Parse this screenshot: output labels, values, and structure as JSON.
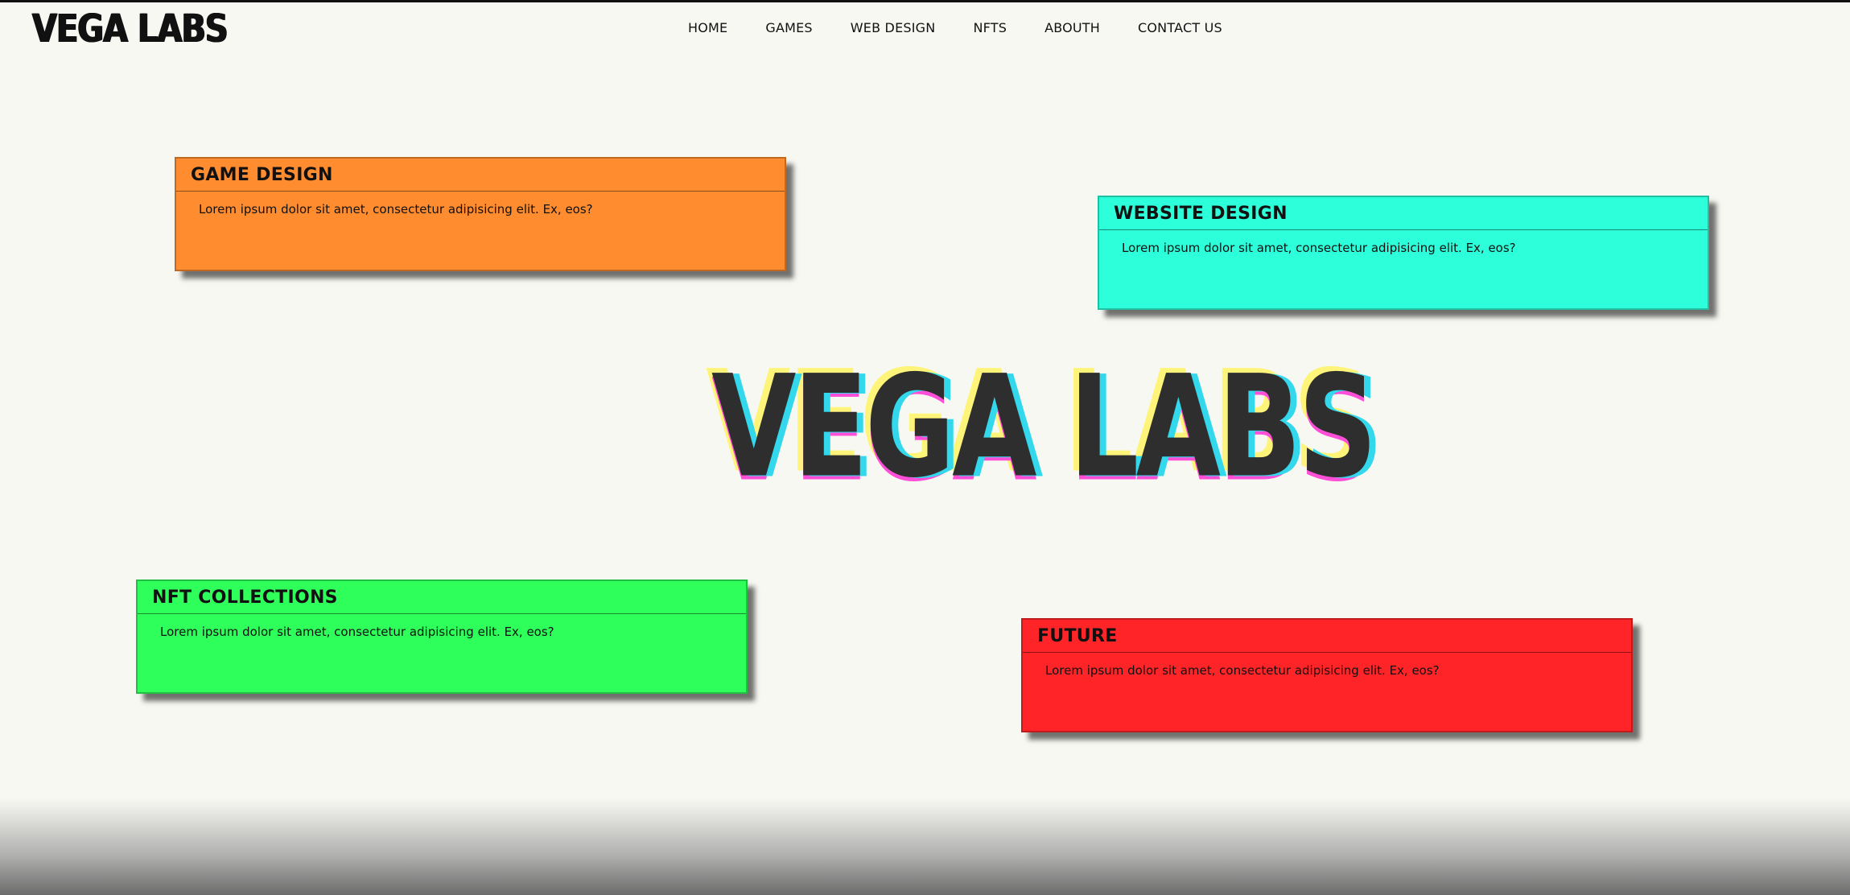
{
  "brand": {
    "logo_text": "VEGA LABS",
    "hero_text": "VEGA LABS"
  },
  "nav": {
    "items": [
      {
        "label": "HOME"
      },
      {
        "label": "GAMES"
      },
      {
        "label": "WEB DESIGN"
      },
      {
        "label": "NFTS"
      },
      {
        "label": "ABOUTH"
      },
      {
        "label": "CONTACT US"
      }
    ]
  },
  "cards": [
    {
      "title": "GAME DESIGN",
      "text": "Lorem ipsum dolor sit amet, consectetur adipisicing elit. Ex, eos?",
      "color": "#ff8c2f"
    },
    {
      "title": "WEBSITE DESIGN",
      "text": "Lorem ipsum dolor sit amet, consectetur adipisicing elit. Ex, eos?",
      "color": "#2cffd9"
    },
    {
      "title": "NFT COLLECTIONS",
      "text": "Lorem ipsum dolor sit amet, consectetur adipisicing elit. Ex, eos?",
      "color": "#2eff5a"
    },
    {
      "title": "FUTURE",
      "text": "Lorem ipsum dolor sit amet, consectetur adipisicing elit. Ex, eos?",
      "color": "#ff2427"
    }
  ],
  "colors": {
    "background": "#f8f8f3",
    "hero_fill": "#2e2e2e",
    "hero_yellow": "#fff47a",
    "hero_magenta": "#ff4fd8",
    "hero_cyan": "#33d8ec"
  }
}
